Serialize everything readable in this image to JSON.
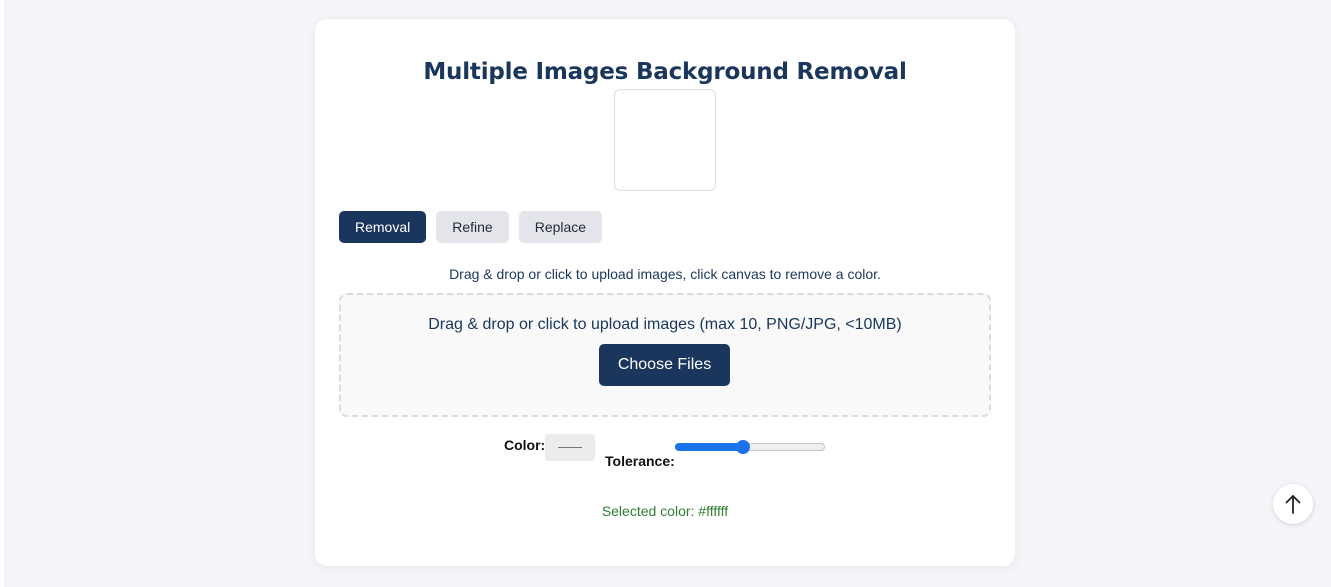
{
  "page": {
    "title": "Multiple Images Background Removal"
  },
  "tabs": [
    {
      "label": "Removal",
      "active": true
    },
    {
      "label": "Refine",
      "active": false
    },
    {
      "label": "Replace",
      "active": false
    }
  ],
  "instructions": "Drag & drop or click to upload images, click canvas to remove a color.",
  "dropzone": {
    "text": "Drag & drop or click to upload images (max 10, PNG/JPG, <10MB)",
    "button_label": "Choose Files"
  },
  "controls": {
    "color_label": "Color:",
    "tolerance_label": "Tolerance:",
    "tolerance_value_fraction": 0.45
  },
  "status": {
    "selected_color_text": "Selected color: #ffffff"
  },
  "icons": {
    "scroll_top": "arrow-up-icon"
  },
  "colors": {
    "primary": "#1b365d",
    "tab_inactive": "#e3e5ea",
    "slider_accent": "#1a73e8",
    "success_text": "#2e7d32",
    "background": "#f3f5f8"
  }
}
